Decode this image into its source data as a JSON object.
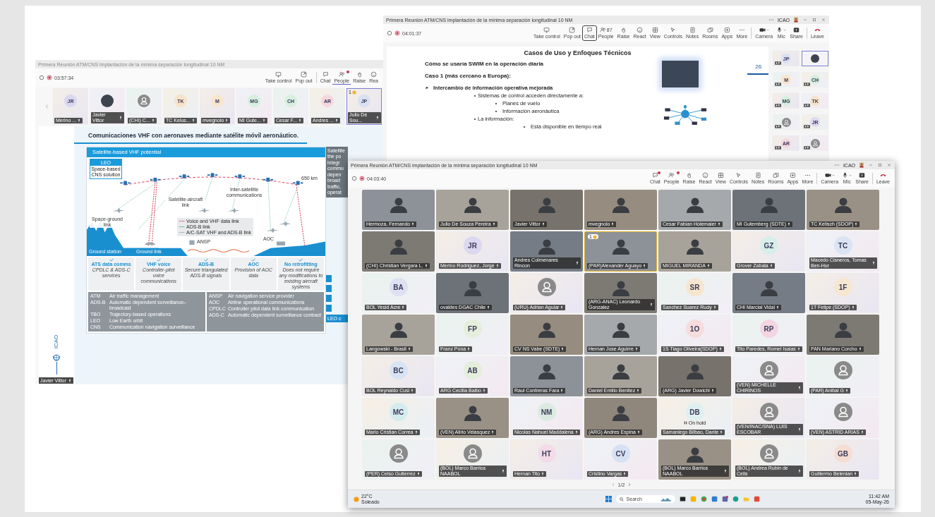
{
  "window_left": {
    "title": "Primera Reunión ATM/CNS implantación de la mínima separación longitudinal 10 NM",
    "timer": "03:57:34",
    "toolbar": [
      {
        "kind": "take_control",
        "label": "Take control",
        "selected": false,
        "badge": false
      },
      {
        "kind": "pop_out",
        "label": "Pop out",
        "selected": false,
        "badge": false
      },
      {
        "kind": "chat",
        "label": "Chat",
        "selected": false,
        "badge": false
      },
      {
        "kind": "people",
        "label": "People",
        "selected": true,
        "badge": true
      },
      {
        "kind": "raise",
        "label": "Raise",
        "selected": false,
        "badge": false
      },
      {
        "kind": "react",
        "label": "Rea",
        "selected": false,
        "badge": false
      }
    ],
    "strip": [
      {
        "kind": "initials",
        "initials": "JR",
        "color": "#d9d6f0",
        "name": "Merino ...",
        "selected": false
      },
      {
        "kind": "video",
        "name": "Javier Vittor",
        "selected": false
      },
      {
        "kind": "avatar",
        "name": "(CHI) C...",
        "selected": false
      },
      {
        "kind": "initials",
        "initials": "TK",
        "color": "#f6e3c9",
        "name": "TC Kelus...",
        "selected": false
      },
      {
        "kind": "initials",
        "initials": "M",
        "color": "#f8e5cd",
        "name": "mvegnolo",
        "selected": false
      },
      {
        "kind": "initials",
        "initials": "MG",
        "color": "#d6efdf",
        "name": "MI Gute...",
        "selected": false
      },
      {
        "kind": "initials",
        "initials": "CH",
        "color": "#d8efe0",
        "name": "Cesar F...",
        "selected": false
      },
      {
        "kind": "initials",
        "initials": "AR",
        "color": "#f5d8de",
        "name": "Andres ...",
        "selected": false
      },
      {
        "kind": "initials",
        "initials": "JP",
        "color": "#d8e0f2",
        "name": "Julio De Sou...",
        "selected": true,
        "hand": "1"
      }
    ],
    "slide": {
      "title": "Comunicaciones VHF con aeronaves mediante satélite móvil aeronáutico.",
      "figure": {
        "heading": "Satellite-based VHF potential",
        "orbit_label": "LEO",
        "orbit_caption": "Space-based CNS solution",
        "altitude": "650 km",
        "inter_satellite": "Inter-satellite communications",
        "satellite_aircraft": "Satellite-aircraft link",
        "space_ground": "Space-ground link",
        "ansp": "ANSP",
        "aoc": "AOC",
        "ground_station": "Ground station",
        "ground_link": "Ground link",
        "legend": [
          {
            "text": "Voice and VHF data link",
            "color": "#d9405a"
          },
          {
            "text": "ADS-B link",
            "color": "#3fa58a"
          },
          {
            "text": "A/C-SAT VHF and ADS-B link",
            "color": "#8c9aa6"
          }
        ],
        "benefits": [
          {
            "title": "ATS data comms",
            "text": "CPDLC & ADS-C services"
          },
          {
            "title": "VHF voice",
            "text": "Controller-pilot voice communications"
          },
          {
            "title": "ADS-B",
            "text": "Secure triangulated ADS-B signals"
          },
          {
            "title": "AOC",
            "text": "Provision of AOC data"
          },
          {
            "title": "No retrofitting",
            "text": "Does not require any modifications to existing aircraft systems"
          }
        ],
        "glossary_left": [
          {
            "abbr": "ATM",
            "meaning": "Air traffic management"
          },
          {
            "abbr": "ADS-B",
            "meaning": "Automatic dependent surveillance–broadcast"
          },
          {
            "abbr": "TBO",
            "meaning": "Trajectory-based operations"
          },
          {
            "abbr": "LEO",
            "meaning": "Low Earth orbit"
          },
          {
            "abbr": "CNS",
            "meaning": "Communication navigation surveillance"
          }
        ],
        "glossary_right": [
          {
            "abbr": "ANSP",
            "meaning": "Air navigation service provider"
          },
          {
            "abbr": "AOC",
            "meaning": "Airline operational communications"
          },
          {
            "abbr": "CPDLC",
            "meaning": "Controller pilot data link communication"
          },
          {
            "abbr": "ADS-C",
            "meaning": "Automatic dependent surveillance contract"
          }
        ]
      },
      "side_panel": {
        "lines": [
          "Satellite",
          "the po",
          "integr",
          "commu",
          "depen",
          "broad",
          "traffic,",
          "operat"
        ],
        "footer": "LEO c"
      }
    },
    "logo": "ICAO",
    "presenter_tag": "Javier Vittor"
  },
  "window_top": {
    "title": "Primera Reunión ATM/CNS implantación de la mínima separación longitudinal 10 NM",
    "account": "ICAO",
    "timer": "04:01:37",
    "toolbar": [
      {
        "kind": "take_control",
        "label": "Take control",
        "selected": false,
        "badge": false
      },
      {
        "kind": "pop_out",
        "label": "Pop out",
        "selected": false,
        "badge": false
      },
      {
        "kind": "chat",
        "label": "Chat",
        "selected": true,
        "badge": false
      },
      {
        "kind": "people",
        "label": "People",
        "count": "87",
        "selected": false,
        "badge": false
      },
      {
        "kind": "raise",
        "label": "Raise",
        "selected": false,
        "badge": false
      },
      {
        "kind": "react",
        "label": "React",
        "selected": false,
        "badge": false
      },
      {
        "kind": "view",
        "label": "View",
        "selected": false,
        "badge": false
      },
      {
        "kind": "controls",
        "label": "Controls",
        "selected": false,
        "badge": false
      },
      {
        "kind": "notes",
        "label": "Notes",
        "selected": false,
        "badge": false
      },
      {
        "kind": "rooms",
        "label": "Rooms",
        "selected": false,
        "badge": false
      },
      {
        "kind": "apps",
        "label": "Apps",
        "selected": false,
        "badge": false
      },
      {
        "kind": "more",
        "label": "More",
        "selected": false,
        "badge": false
      },
      {
        "kind": "camera",
        "label": "Camera",
        "selected": false,
        "badge": false
      },
      {
        "kind": "mic",
        "label": "Mic",
        "selected": false,
        "badge": false
      },
      {
        "kind": "share",
        "label": "Share",
        "selected": false,
        "badge": false
      },
      {
        "kind": "leave",
        "label": "Leave",
        "selected": false,
        "badge": false
      }
    ],
    "slide": {
      "title": "Casos de Uso y Enfoques Técnicos",
      "subtitle": "Cómo se usaría SWIM en la operación diaria",
      "page_number": "26",
      "case": "Caso 1 (más cercano a Europa):",
      "points": [
        {
          "text": "Intercambio de información operativa mejorada",
          "children": [
            {
              "text": "Sistemas de control acceden directamente a:",
              "children": [
                {
                  "text": "Planes de vuelo"
                },
                {
                  "text": "Información aeronáutica"
                }
              ]
            },
            {
              "text": "La información:",
              "children": [
                {
                  "text": "Está disponible en tiempo real"
                }
              ]
            }
          ]
        }
      ]
    },
    "panel": [
      {
        "kind": "initials",
        "initials": "JP",
        "color": "#d8e0f2",
        "selected": false
      },
      {
        "kind": "video",
        "selected": true
      },
      {
        "kind": "initials",
        "initials": "M",
        "color": "#f8e5cd",
        "selected": false
      },
      {
        "kind": "initials",
        "initials": "CH",
        "color": "#d6efdf",
        "selected": false
      },
      {
        "kind": "initials",
        "initials": "MG",
        "color": "#d6efdf",
        "selected": false
      },
      {
        "kind": "initials",
        "initials": "TK",
        "color": "#f6e3c9",
        "selected": false
      },
      {
        "kind": "avatar",
        "selected": false
      },
      {
        "kind": "initials",
        "initials": "JR",
        "color": "#dcd8f0",
        "selected": false
      },
      {
        "kind": "initials",
        "initials": "AR",
        "color": "#f5d8de",
        "selected": false
      },
      {
        "kind": "avatar",
        "selected": false
      }
    ]
  },
  "window_front": {
    "title": "Primera Reunión ATM/CNS implantación de la mínima separación longitudinal 10 NM",
    "account": "ICAO",
    "timer": "04:03:40",
    "toolbar": [
      {
        "kind": "chat",
        "label": "Chat",
        "selected": false,
        "badge": true
      },
      {
        "kind": "people",
        "label": "People",
        "selected": false,
        "badge": true
      },
      {
        "kind": "raise",
        "label": "Raise",
        "selected": false,
        "badge": false
      },
      {
        "kind": "react",
        "label": "React",
        "selected": false,
        "badge": false
      },
      {
        "kind": "view",
        "label": "View",
        "selected": false,
        "badge": false
      },
      {
        "kind": "controls",
        "label": "Controls",
        "selected": false,
        "badge": false
      },
      {
        "kind": "notes",
        "label": "Notes",
        "selected": false,
        "badge": false
      },
      {
        "kind": "rooms",
        "label": "Rooms",
        "selected": false,
        "badge": false
      },
      {
        "kind": "apps",
        "label": "Apps",
        "selected": false,
        "badge": false
      },
      {
        "kind": "more",
        "label": "More",
        "selected": false,
        "badge": false
      },
      {
        "kind": "camera",
        "label": "Camera",
        "selected": false,
        "badge": false
      },
      {
        "kind": "mic",
        "label": "Mic",
        "selected": false,
        "badge": false
      },
      {
        "kind": "share",
        "label": "Share",
        "selected": false,
        "badge": false
      },
      {
        "kind": "leave",
        "label": "Leave",
        "selected": false,
        "badge": false
      }
    ],
    "tiles": [
      {
        "kind": "video",
        "name": "Hermoza, Fernando",
        "highlighted": false
      },
      {
        "kind": "video",
        "name": "Julio De Souza Pereira",
        "highlighted": false
      },
      {
        "kind": "video",
        "name": "Javier Vittor",
        "highlighted": false
      },
      {
        "kind": "video",
        "name": "mvegnolo",
        "highlighted": false
      },
      {
        "kind": "video",
        "name": "Cesar Fabian Holemaier",
        "highlighted": false
      },
      {
        "kind": "video",
        "name": "MI Gutemberg (SDTE)",
        "highlighted": false
      },
      {
        "kind": "video",
        "name": "TC Kelisch (SDOP)",
        "highlighted": false
      },
      {
        "kind": "video",
        "name": "(CHI) Christian Vergara L.",
        "highlighted": false
      },
      {
        "kind": "initials",
        "initials": "JR",
        "color": "#dcd8f0",
        "name": "Merino Rodriguez, Jorge",
        "highlighted": false
      },
      {
        "kind": "video",
        "name": "Andres Colmenares Rincon",
        "highlighted": false
      },
      {
        "kind": "video",
        "name": "(PAR)Alexander Aguayo",
        "highlighted": true,
        "hand": "1"
      },
      {
        "kind": "video",
        "name": "MIGUEL MIRANDA",
        "highlighted": false
      },
      {
        "kind": "initials",
        "initials": "GZ",
        "color": "#d8efe9",
        "name": "Grover Zabala",
        "highlighted": false
      },
      {
        "kind": "initials",
        "initials": "TC",
        "color": "#dbe4f4",
        "name": "Macedo Cisneros, Tomas Ben-Hur",
        "highlighted": false
      },
      {
        "kind": "initials",
        "initials": "BA",
        "color": "#dfe0f2",
        "name": "BOL Yesid Acre",
        "highlighted": false
      },
      {
        "kind": "video",
        "name": "ovaldes DGAC Chile",
        "highlighted": false
      },
      {
        "kind": "avatar",
        "name": "(URU) Adrian Aguiar",
        "highlighted": false
      },
      {
        "kind": "video",
        "name": "(ARG-ANAC) Leonardo Gonzalez",
        "highlighted": false
      },
      {
        "kind": "initials",
        "initials": "SR",
        "color": "#f6e6cf",
        "name": "Sanchez Suarez Rudy",
        "highlighted": false
      },
      {
        "kind": "video",
        "name": "CHI Marcial Vidal",
        "highlighted": false
      },
      {
        "kind": "initials",
        "initials": "1F",
        "color": "#f7e6d0",
        "name": "1T Felipe (SDOP)",
        "highlighted": false
      },
      {
        "kind": "video",
        "name": "Langowski - Brasil",
        "highlighted": false
      },
      {
        "kind": "initials",
        "initials": "FP",
        "color": "#e4eedb",
        "name": "Franz Pona",
        "highlighted": false
      },
      {
        "kind": "video",
        "name": "CV NS Vabe (SDTE)",
        "highlighted": false
      },
      {
        "kind": "video",
        "name": "Hernan Jose Aguirre",
        "highlighted": false
      },
      {
        "kind": "initials",
        "initials": "1O",
        "color": "#f6dcdc",
        "name": "1S Tiago Oliveira(SDOP)",
        "highlighted": false
      },
      {
        "kind": "initials",
        "initials": "RP",
        "color": "#f3d6e2",
        "name": "Tito Paredes, Romel Isaias",
        "highlighted": false
      },
      {
        "kind": "video",
        "name": "PAN Mariano Corcho",
        "highlighted": false
      },
      {
        "kind": "initials",
        "initials": "BC",
        "color": "#d8e4f4",
        "name": "BOL Reynaldo Cusi",
        "highlighted": false
      },
      {
        "kind": "initials",
        "initials": "AB",
        "color": "#e3eedb",
        "name": "ARG Cecilia Balbo",
        "highlighted": false
      },
      {
        "kind": "video",
        "name": "Raul Contreras Fara",
        "highlighted": false
      },
      {
        "kind": "video",
        "name": "Daniel Emilio Benitez",
        "highlighted": false
      },
      {
        "kind": "video",
        "name": "(ARG) Javier Dowichi",
        "highlighted": false
      },
      {
        "kind": "avatar",
        "name": "(VEN) MICHELLE CHIRINOS",
        "highlighted": false
      },
      {
        "kind": "avatar",
        "name": "(PAR) Anibal G",
        "highlighted": false
      },
      {
        "kind": "initials",
        "initials": "MC",
        "color": "#d5ecef",
        "name": "Mario Cristian Correa",
        "highlighted": false
      },
      {
        "kind": "video",
        "name": "(VEN) Alirio Velasquez",
        "highlighted": false
      },
      {
        "kind": "initials",
        "initials": "NM",
        "color": "#dcebe2",
        "name": "Nicolas Nahuel Maddalena",
        "highlighted": false
      },
      {
        "kind": "video",
        "name": "(ARG) Andres Espina",
        "highlighted": false
      },
      {
        "kind": "initials",
        "initials": "DB",
        "color": "#e0eff0",
        "name": "Samaniego Bilbao, Dante",
        "status": "On hold",
        "highlighted": false
      },
      {
        "kind": "avatar",
        "name": "(VEN/INAC/SNA) LUIS ESCOBAR",
        "highlighted": false
      },
      {
        "kind": "avatar",
        "name": "(VEN) ASTRID ARIAS",
        "highlighted": false
      },
      {
        "kind": "avatar",
        "name": "(PER) Celso Gutierrez",
        "highlighted": false
      },
      {
        "kind": "avatar",
        "name": "(BOL) Marco Barrios NAABOL",
        "highlighted": false
      },
      {
        "kind": "initials",
        "initials": "HT",
        "color": "#f3dbe9",
        "name": "Hernan Tito",
        "highlighted": false
      },
      {
        "kind": "initials",
        "initials": "CV",
        "color": "#d7e1f4",
        "name": "Cristino Vargas",
        "highlighted": false
      },
      {
        "kind": "video",
        "name": "(BOL) Marco Barrios NAABOL",
        "highlighted": false
      },
      {
        "kind": "avatar",
        "name": "(BOL) Andrea Rubin de Celis",
        "highlighted": false
      },
      {
        "kind": "initials",
        "initials": "GB",
        "color": "#f6ddd3",
        "name": "Guillermo Belenian",
        "highlighted": false
      }
    ],
    "pager": "1/2"
  },
  "taskbar": {
    "temperature": "22°C",
    "condition": "Soleado",
    "search": "Search",
    "time": "11:42 AM",
    "date": "05-May-26"
  }
}
